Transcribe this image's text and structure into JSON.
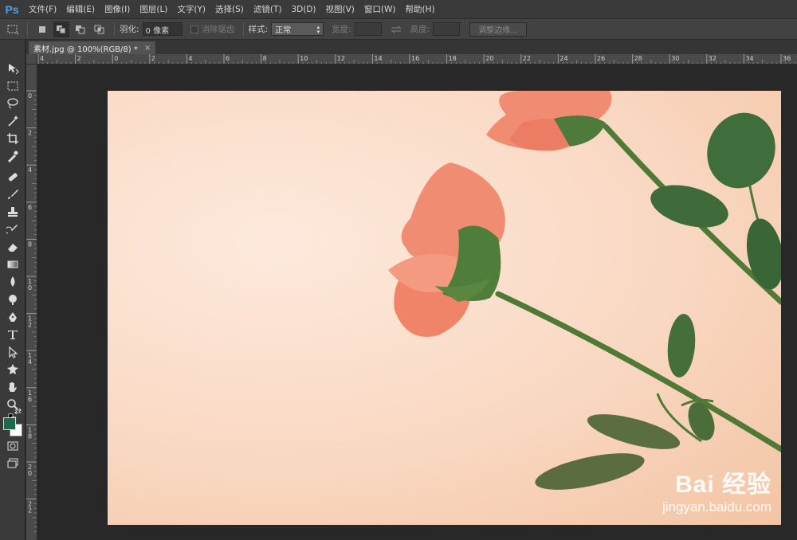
{
  "app": {
    "logo": "Ps"
  },
  "menu": [
    "文件(F)",
    "编辑(E)",
    "图像(I)",
    "图层(L)",
    "文字(Y)",
    "选择(S)",
    "滤镜(T)",
    "3D(D)",
    "视图(V)",
    "窗口(W)",
    "帮助(H)"
  ],
  "options": {
    "feather_label": "羽化:",
    "feather_value": "0 像素",
    "antialias_label": "消除锯齿",
    "style_label": "样式:",
    "style_value": "正常",
    "width_label": "宽度:",
    "height_label": "高度:",
    "refine_edge_button": "调整边缘..."
  },
  "document": {
    "tab_title": "素材.jpg @ 100%(RGB/8) *"
  },
  "ruler": {
    "top_labels": [
      "4",
      "2",
      "0",
      "2",
      "4",
      "6",
      "8",
      "10",
      "12",
      "14",
      "16",
      "18",
      "20",
      "22",
      "24",
      "26",
      "28",
      "30",
      "32",
      "34",
      "36"
    ],
    "left_labels": [
      "0",
      "2",
      "4",
      "6",
      "8",
      "1 0",
      "1 2",
      "1 4",
      "1 6",
      "1 8",
      "2 0",
      "2 2"
    ]
  },
  "colors": {
    "foreground": "#1d6a4a",
    "background": "#ffffff",
    "accent": "#4fa3e6"
  },
  "tools": [
    "move-icon",
    "marquee-icon",
    "lasso-icon",
    "magic-wand-icon",
    "crop-icon",
    "eyedropper-icon",
    "healing-brush-icon",
    "brush-icon",
    "clone-stamp-icon",
    "history-brush-icon",
    "eraser-icon",
    "gradient-icon",
    "blur-icon",
    "dodge-icon",
    "pen-icon",
    "type-icon",
    "path-selection-icon",
    "shape-icon",
    "hand-icon",
    "zoom-icon"
  ],
  "watermark": {
    "main": "Bai 经验",
    "sub": "jingyan.baidu.com"
  }
}
